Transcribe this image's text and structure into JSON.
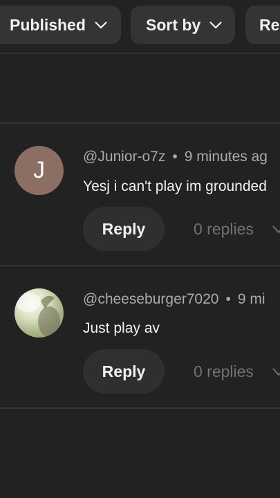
{
  "filters": {
    "published_label": "Published",
    "sort_label": "Sort by",
    "third_label": "Re"
  },
  "comments": [
    {
      "avatar_letter": "J",
      "avatar_color": "#8d6e63",
      "author": "@Junior-o7z",
      "time": "9 minutes ag",
      "text": "Yesj i can't  play im grounded",
      "reply_label": "Reply",
      "replies_label": "0 replies"
    },
    {
      "author": "@cheeseburger7020",
      "time": "9 mi",
      "text": "Just play av",
      "reply_label": "Reply",
      "replies_label": "0 replies"
    }
  ],
  "colors": {
    "background": "#222222",
    "chip": "#343434",
    "reply_button": "#2f2f2f",
    "muted_text": "#aaaaaa"
  },
  "icons": [
    "chevron-down-icon"
  ]
}
